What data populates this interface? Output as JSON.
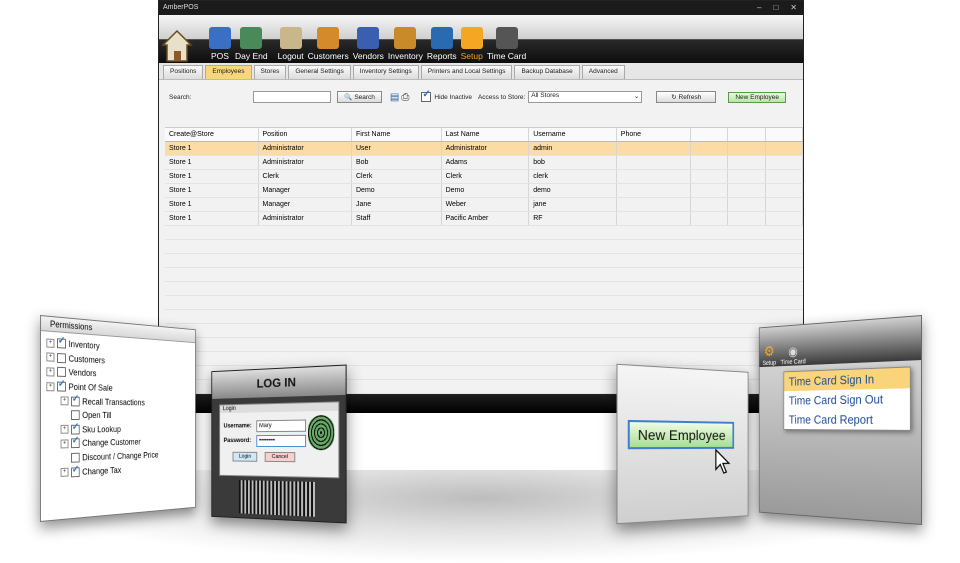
{
  "window": {
    "title": "AmberPOS",
    "controls": [
      "–",
      "□",
      "✕"
    ]
  },
  "ribbon": {
    "buttons": [
      {
        "label": "POS",
        "color": "#3a6fc4"
      },
      {
        "label": "Day End",
        "color": "#4a8a5a"
      },
      {
        "label": "Logout",
        "color": "#c9b68a"
      },
      {
        "label": "Customers",
        "color": "#d48a2a"
      },
      {
        "label": "Vendors",
        "color": "#3a5fb0"
      },
      {
        "label": "Inventory",
        "color": "#c98a2a"
      },
      {
        "label": "Reports",
        "color": "#2a6ab0"
      },
      {
        "label": "Setup",
        "color": "#f5a623"
      },
      {
        "label": "Time Card",
        "color": "#555555"
      }
    ]
  },
  "tabs": [
    "Positions",
    "Employees",
    "Stores",
    "General Settings",
    "Inventory Settings",
    "Printers and Local Settings",
    "Backup Database",
    "Advanced"
  ],
  "toolbar": {
    "search_label": "Search:",
    "search_value": "",
    "search_button": "Search",
    "hide_inactive": "Hide Inactive",
    "access_label": "Access to Store:",
    "access_value": "All Stores",
    "refresh": "Refresh",
    "new_employee": "New Employee"
  },
  "grid": {
    "headers": [
      "Create@Store",
      "Position",
      "First Name",
      "Last Name",
      "Username",
      "Phone"
    ],
    "rows": [
      [
        "Store 1",
        "Administrator",
        "User",
        "Administrator",
        "admin",
        ""
      ],
      [
        "Store 1",
        "Administrator",
        "Bob",
        "Adams",
        "bob",
        ""
      ],
      [
        "Store 1",
        "Clerk",
        "Clerk",
        "Clerk",
        "clerk",
        ""
      ],
      [
        "Store 1",
        "Manager",
        "Demo",
        "Demo",
        "demo",
        ""
      ],
      [
        "Store 1",
        "Manager",
        "Jane",
        "Weber",
        "jane",
        ""
      ],
      [
        "Store 1",
        "Administrator",
        "Staff",
        "Pacific Amber",
        "RF",
        ""
      ]
    ]
  },
  "permissions": {
    "title": "Permissions",
    "items": [
      {
        "label": "Inventory",
        "level": 0,
        "checked": true
      },
      {
        "label": "Customers",
        "level": 0,
        "checked": false
      },
      {
        "label": "Vendors",
        "level": 0,
        "checked": false
      },
      {
        "label": "Point Of Sale",
        "level": 0,
        "checked": true
      },
      {
        "label": "Recall Transactions",
        "level": 1,
        "checked": true
      },
      {
        "label": "Open Till",
        "level": 1,
        "checked": false
      },
      {
        "label": "Sku Lookup",
        "level": 1,
        "checked": true
      },
      {
        "label": "Change Customer",
        "level": 1,
        "checked": true
      },
      {
        "label": "Discount / Change Price",
        "level": 1,
        "checked": false
      },
      {
        "label": "Change Tax",
        "level": 1,
        "checked": true
      }
    ]
  },
  "login": {
    "banner": "LOG IN",
    "dialog_title": "Login",
    "username_label": "Username:",
    "username_value": "Mary",
    "password_label": "Password:",
    "password_value": "••••••••",
    "login_button": "Login",
    "cancel_button": "Cancel"
  },
  "new_employee_card": {
    "button": "New Employee"
  },
  "timecard": {
    "setup_label": "Setup",
    "timecard_label": "Time Card",
    "menu": [
      "Time Card Sign In",
      "Time Card Sign Out",
      "Time Card Report"
    ]
  }
}
